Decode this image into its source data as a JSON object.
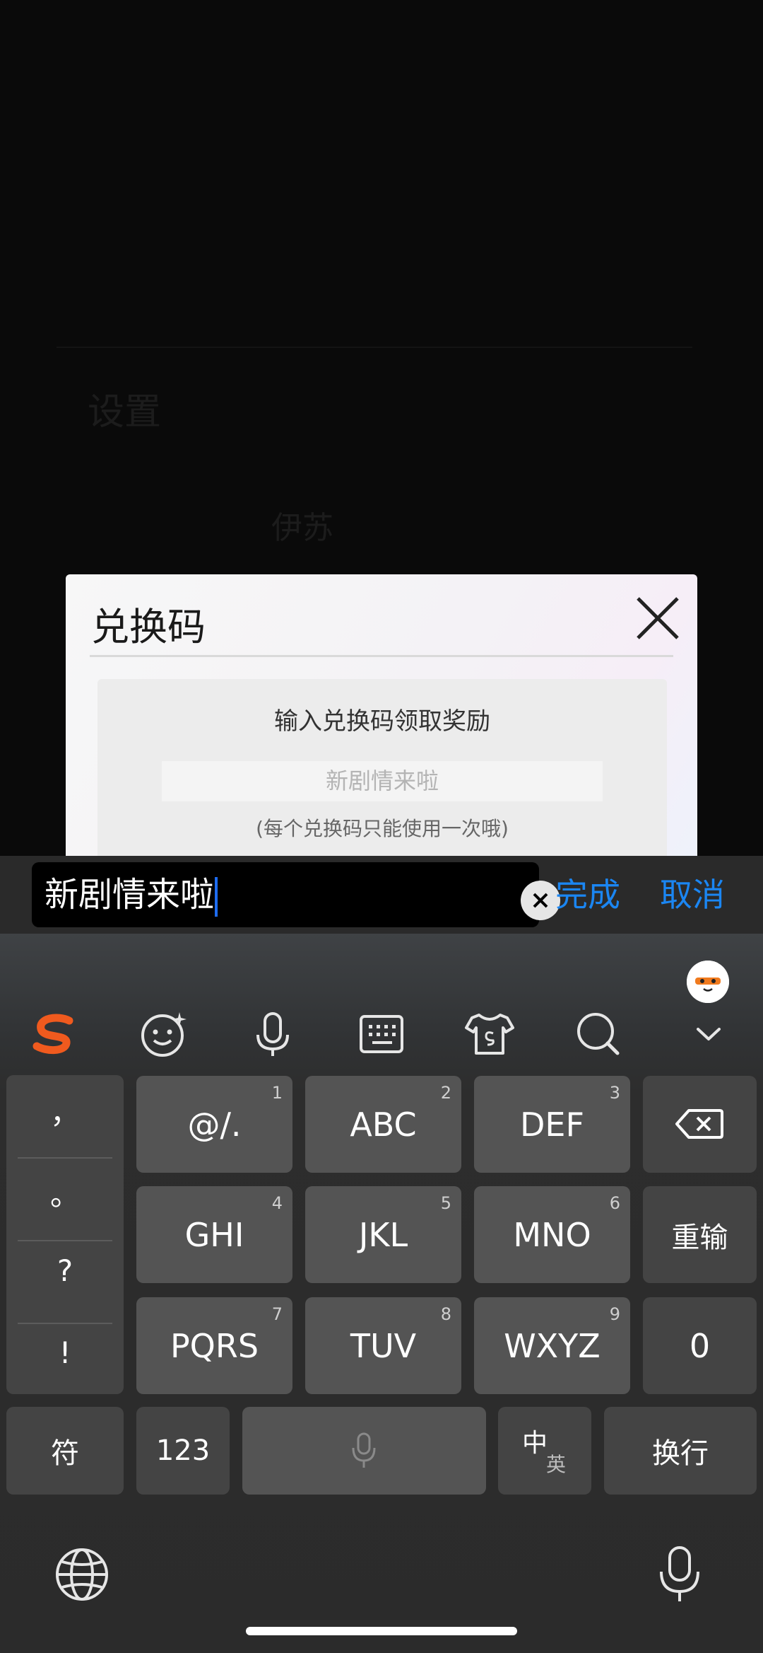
{
  "background": {
    "ghost_title": "设置",
    "ghost_name": "伊苏"
  },
  "dialog": {
    "title": "兑换码",
    "prompt": "输入兑换码领取奖励",
    "input_value": "新剧情来啦",
    "note": "(每个兑换码只能使用一次哦)"
  },
  "input_bar": {
    "value": "新剧情来啦",
    "done_label": "完成",
    "cancel_label": "取消"
  },
  "keyboard": {
    "toolbar": [
      "sogou-logo-icon",
      "emoji-icon",
      "voice-icon",
      "keyboard-icon",
      "skin-icon",
      "search-icon",
      "collapse-icon"
    ],
    "punctuation": [
      "，",
      "。",
      "?",
      "!"
    ],
    "keys": [
      {
        "label": "@/.",
        "num": "1"
      },
      {
        "label": "ABC",
        "num": "2"
      },
      {
        "label": "DEF",
        "num": "3"
      },
      {
        "label": "GHI",
        "num": "4"
      },
      {
        "label": "JKL",
        "num": "5"
      },
      {
        "label": "MNO",
        "num": "6"
      },
      {
        "label": "PQRS",
        "num": "7"
      },
      {
        "label": "TUV",
        "num": "8"
      },
      {
        "label": "WXYZ",
        "num": "9"
      }
    ],
    "retype_label": "重输",
    "zero_label": "0",
    "symbol_label": "符",
    "numeric_label": "123",
    "lang_top": "中",
    "lang_bottom": "英",
    "enter_label": "换行",
    "accent": "#f05a1e"
  },
  "colors": {
    "link_blue": "#1b86f2",
    "key_bg": "#545454",
    "dialog_bg": "#f5f3f6"
  }
}
